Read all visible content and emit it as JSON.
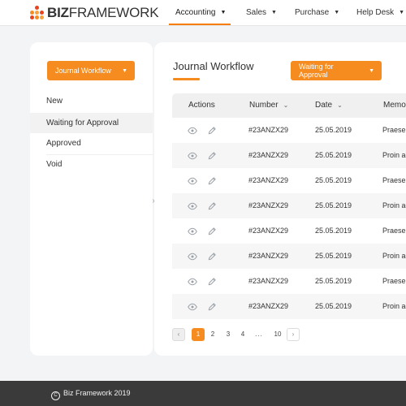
{
  "brand": {
    "name_bold": "BIZ",
    "name_rest": "FRAMEWORK",
    "accent": "#f68b1f",
    "logo_icon": "dots-logo-icon"
  },
  "nav": {
    "items": [
      {
        "label": "Accounting",
        "active": true
      },
      {
        "label": "Sales",
        "active": false
      },
      {
        "label": "Purchase",
        "active": false
      },
      {
        "label": "Help Desk",
        "active": false
      }
    ]
  },
  "sidebar": {
    "workflow_button": "Journal Workflow",
    "statuses": [
      {
        "label": "New",
        "selected": false
      },
      {
        "label": "Waiting for Approval",
        "selected": true
      },
      {
        "label": "Approved",
        "selected": false
      },
      {
        "label": "Void",
        "selected": false
      }
    ],
    "collapse_icon": "chevron-right-icon"
  },
  "main": {
    "title": "Journal Workflow",
    "status_filter": "Waiting for Approval",
    "table": {
      "columns": [
        "Actions",
        "Number",
        "Date",
        "Memo"
      ],
      "rows": [
        {
          "number": "#23ANZX29",
          "date": "25.05.2019",
          "memo": "Praesen"
        },
        {
          "number": "#23ANZX29",
          "date": "25.05.2019",
          "memo": "Proin ac"
        },
        {
          "number": "#23ANZX29",
          "date": "25.05.2019",
          "memo": "Praesen"
        },
        {
          "number": "#23ANZX29",
          "date": "25.05.2019",
          "memo": "Proin ac"
        },
        {
          "number": "#23ANZX29",
          "date": "25.05.2019",
          "memo": "Praesen"
        },
        {
          "number": "#23ANZX29",
          "date": "25.05.2019",
          "memo": "Proin ac"
        },
        {
          "number": "#23ANZX29",
          "date": "25.05.2019",
          "memo": "Praesen"
        },
        {
          "number": "#23ANZX29",
          "date": "25.05.2019",
          "memo": "Proin ac"
        }
      ]
    },
    "pagination": {
      "pages": [
        "1",
        "2",
        "3",
        "4",
        "...",
        "10"
      ],
      "current": "1"
    }
  },
  "footer": {
    "text": "Biz Framework 2019"
  }
}
